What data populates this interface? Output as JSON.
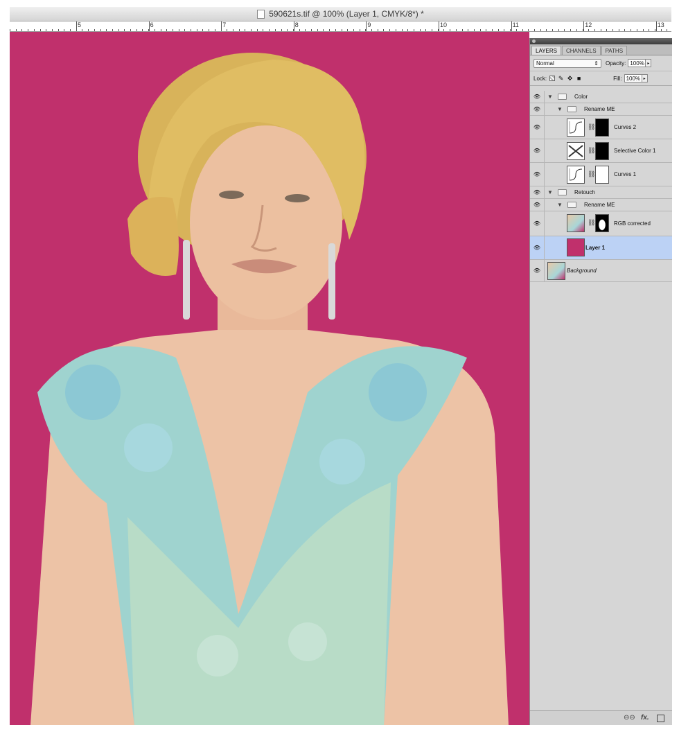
{
  "window": {
    "title": "590621s.tif @ 100% (Layer 1, CMYK/8*) *"
  },
  "ruler": {
    "labels": [
      "5",
      "6",
      "7",
      "8",
      "9",
      "10",
      "11",
      "12",
      "13"
    ]
  },
  "colors": {
    "canvas_bg": "#c0306c",
    "selected_row": "#bcd2f5"
  },
  "layers_panel": {
    "tabs": [
      "LAYERS",
      "CHANNELS",
      "PATHS"
    ],
    "blend_mode": "Normal",
    "opacity_label": "Opacity:",
    "opacity_value": "100%",
    "lock_label": "Lock:",
    "fill_label": "Fill:",
    "fill_value": "100%",
    "items": [
      {
        "name": "Color",
        "kind": "group"
      },
      {
        "name": "Rename ME",
        "kind": "group"
      },
      {
        "name": "Curves 2",
        "kind": "adjustment"
      },
      {
        "name": "Selective Color 1",
        "kind": "adjustment"
      },
      {
        "name": "Curves 1",
        "kind": "adjustment"
      },
      {
        "name": "Retouch",
        "kind": "group"
      },
      {
        "name": "Rename ME",
        "kind": "group"
      },
      {
        "name": "RGB corrected",
        "kind": "pixel"
      },
      {
        "name": "Layer 1",
        "kind": "fill",
        "selected": true
      },
      {
        "name": "Background",
        "kind": "background"
      }
    ],
    "icons": [
      "eye-icon",
      "folder-icon",
      "chain-icon",
      "link-layers-icon",
      "fx-icon",
      "new-layer-icon"
    ]
  }
}
